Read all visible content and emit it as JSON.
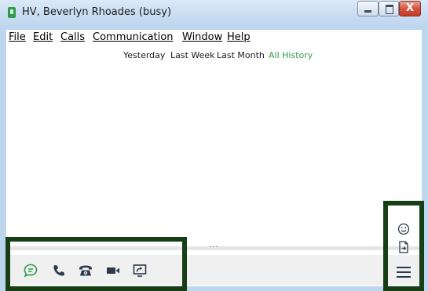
{
  "window": {
    "title": "HV, Beverlyn Rhoades (busy)",
    "controls": [
      "minimize",
      "maximize",
      "close"
    ],
    "close_glyph": "X"
  },
  "menu": {
    "items": [
      {
        "label": "File"
      },
      {
        "label": "Edit"
      },
      {
        "label": "Calls"
      },
      {
        "label": "Communication"
      },
      {
        "label": "Window"
      },
      {
        "label": "Help"
      }
    ]
  },
  "history_filters": {
    "items": [
      {
        "label": "Yesterday"
      },
      {
        "label": "Last Week"
      },
      {
        "label": "Last Month"
      },
      {
        "label": "All History"
      }
    ],
    "active": "All History",
    "active_color": "#2e9c4a"
  },
  "splitter": {
    "handle": "..."
  },
  "toolbar": {
    "icons": [
      "chat-icon",
      "phone-icon",
      "desk-phone-icon",
      "video-camera-icon",
      "screen-share-icon"
    ],
    "accent": "#2e9c4a"
  },
  "side_panel": {
    "icons": [
      "emoji-icon",
      "attach-file-icon",
      "menu-icon"
    ]
  },
  "highlight_color": "#163f16"
}
